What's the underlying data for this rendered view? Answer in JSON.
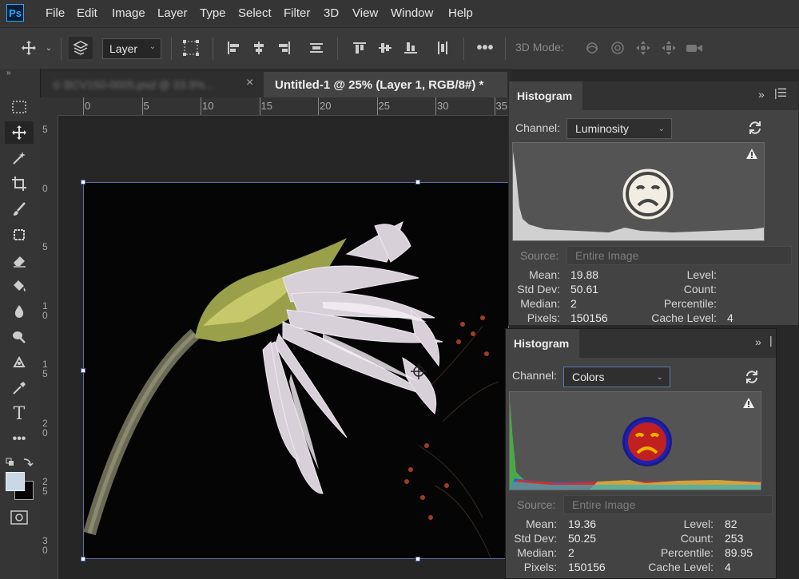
{
  "app": {
    "logo": "Ps"
  },
  "menu": [
    "File",
    "Edit",
    "Image",
    "Layer",
    "Type",
    "Select",
    "Filter",
    "3D",
    "View",
    "Window",
    "Help"
  ],
  "options": {
    "auto_select_value": "Layer",
    "mode_3d_label": "3D Mode:"
  },
  "tabs": {
    "inactive_title": "© BCV150-0005.psd @ 33.3%...",
    "close_glyph": "×",
    "active_title": "Untitled-1 @ 25% (Layer 1, RGB/8#) *"
  },
  "rulers": {
    "horizontal": [
      "0",
      "5",
      "10",
      "15",
      "20",
      "25",
      "30",
      "35"
    ],
    "vertical": [
      "5",
      "0",
      "5",
      "1\n0",
      "1\n5",
      "2\n0",
      "2\n5",
      "3\n0"
    ]
  },
  "histogram_top": {
    "tab_label": "Histogram",
    "channel_label": "Channel:",
    "channel_value": "Luminosity",
    "source_label": "Source:",
    "source_value": "Entire Image",
    "stats": {
      "mean_label": "Mean:",
      "mean": "19.88",
      "std_label": "Std Dev:",
      "std": "50.61",
      "median_label": "Median:",
      "median": "2",
      "pixels_label": "Pixels:",
      "pixels": "150156",
      "level_label": "Level:",
      "level": "",
      "count_label": "Count:",
      "count": "",
      "percentile_label": "Percentile:",
      "percentile": "",
      "cache_label": "Cache Level:",
      "cache": "4"
    }
  },
  "histogram_bottom": {
    "tab_label": "Histogram",
    "channel_label": "Channel:",
    "channel_value": "Colors",
    "source_label": "Source:",
    "source_value": "Entire Image",
    "stats": {
      "mean_label": "Mean:",
      "mean": "19.36",
      "std_label": "Std Dev:",
      "std": "50.25",
      "median_label": "Median:",
      "median": "2",
      "pixels_label": "Pixels:",
      "pixels": "150156",
      "level_label": "Level:",
      "level": "82",
      "count_label": "Count:",
      "count": "253",
      "percentile_label": "Percentile:",
      "percentile": "89.95",
      "cache_label": "Cache Level:",
      "cache": "4"
    }
  },
  "colors": {
    "accent": "#31a8ff",
    "panel": "#434343",
    "canvas": "#262626"
  }
}
